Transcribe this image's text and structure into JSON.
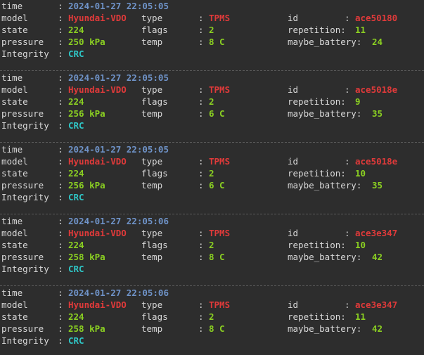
{
  "colors": {
    "background": "#2d2d2d",
    "label": "#d8d8d8",
    "time": "#6f93c8",
    "model": "#e03a3a",
    "number": "#8bd022",
    "integrity": "#2fc6c6",
    "separator": "#5a5a5a"
  },
  "labels": {
    "time": "time",
    "model": "model",
    "state": "state",
    "pressure": "pressure",
    "integrity": "Integrity",
    "type": "type",
    "flags": "flags",
    "temp": "temp",
    "id": "id",
    "repetition": "repetition:",
    "battery": "maybe_battery:",
    "colon": ":"
  },
  "records": [
    {
      "time": "2024-01-27 22:05:05",
      "model": "Hyundai-VDO",
      "type": "TPMS",
      "id": "ace50180",
      "state": "224",
      "flags": "2",
      "repetition": "11",
      "pressure": "250 kPa",
      "temp": "8 C",
      "battery": "24",
      "integrity": "CRC"
    },
    {
      "time": "2024-01-27 22:05:05",
      "model": "Hyundai-VDO",
      "type": "TPMS",
      "id": "ace5018e",
      "state": "224",
      "flags": "2",
      "repetition": "9",
      "pressure": "256 kPa",
      "temp": "6 C",
      "battery": "35",
      "integrity": "CRC"
    },
    {
      "time": "2024-01-27 22:05:05",
      "model": "Hyundai-VDO",
      "type": "TPMS",
      "id": "ace5018e",
      "state": "224",
      "flags": "2",
      "repetition": "10",
      "pressure": "256 kPa",
      "temp": "6 C",
      "battery": "35",
      "integrity": "CRC"
    },
    {
      "time": "2024-01-27 22:05:06",
      "model": "Hyundai-VDO",
      "type": "TPMS",
      "id": "ace3e347",
      "state": "224",
      "flags": "2",
      "repetition": "10",
      "pressure": "258 kPa",
      "temp": "8 C",
      "battery": "42",
      "integrity": "CRC"
    },
    {
      "time": "2024-01-27 22:05:06",
      "model": "Hyundai-VDO",
      "type": "TPMS",
      "id": "ace3e347",
      "state": "224",
      "flags": "2",
      "repetition": "11",
      "pressure": "258 kPa",
      "temp": "8 C",
      "battery": "42",
      "integrity": "CRC"
    }
  ]
}
